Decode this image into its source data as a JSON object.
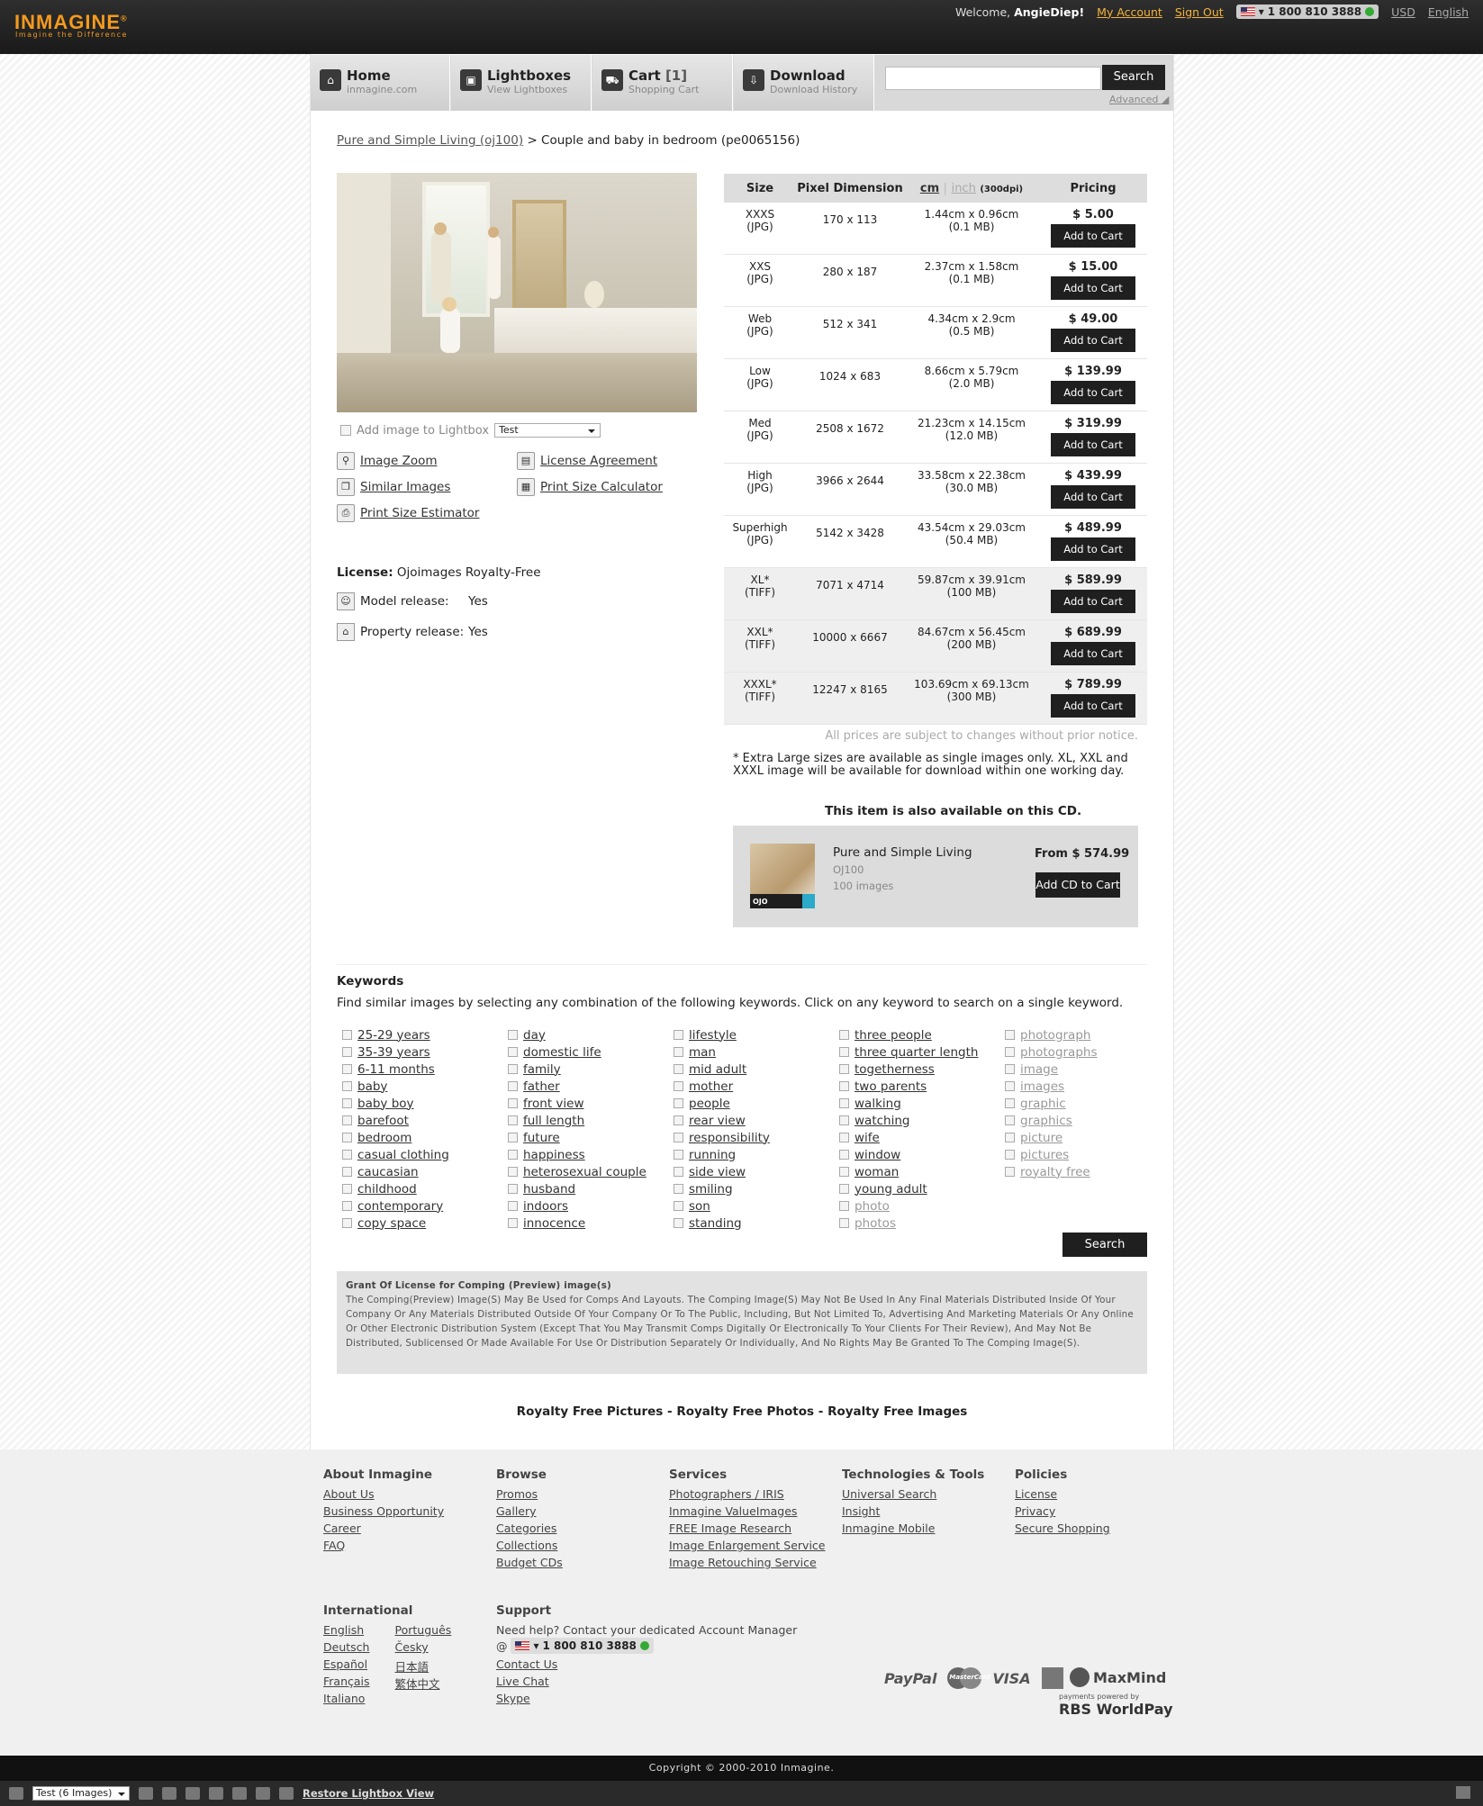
{
  "header": {
    "logo": "INMAGINE",
    "logo_mark": "®",
    "tagline": "Imagine the Difference",
    "welcome": "Welcome,",
    "username": "AngieDiep!",
    "my_account": "My Account",
    "sign_out": "Sign Out",
    "phone": "1 800 810 3888",
    "currency": "USD",
    "language": "English"
  },
  "nav": {
    "tabs": [
      {
        "title": "Home",
        "sub": "inmagine.com"
      },
      {
        "title": "Lightboxes",
        "sub": "View Lightboxes"
      },
      {
        "title": "Cart",
        "count": "[1]",
        "sub": "Shopping Cart"
      },
      {
        "title": "Download",
        "sub": "Download History"
      }
    ],
    "search_placeholder": "",
    "search_button": "Search",
    "advanced": "Advanced"
  },
  "breadcrumb": {
    "parent": "Pure and Simple Living (oj100)",
    "separator": ">",
    "current": "Couple and baby in bedroom (pe0065156)"
  },
  "image_panel": {
    "add_lightbox_label": "Add image to Lightbox",
    "lightbox_select": "Test",
    "tools": {
      "zoom": "Image Zoom",
      "license_agreement": "License Agreement",
      "similar": "Similar Images",
      "print_calc": "Print Size Calculator",
      "print_estimator": "Print Size Estimator"
    },
    "license_label": "License:",
    "license_value": "Ojoimages Royalty-Free",
    "model_release_label": "Model release:",
    "model_release_value": "Yes",
    "property_release_label": "Property release:",
    "property_release_value": "Yes"
  },
  "pricing": {
    "headers": {
      "size": "Size",
      "pixel": "Pixel Dimension",
      "cm": "cm",
      "sep": "|",
      "inch": "inch",
      "dpi": "(300dpi)",
      "pricing": "Pricing"
    },
    "add_label": "Add to Cart",
    "rows": [
      {
        "size": "XXXS",
        "fmt": "(JPG)",
        "pixels": "170 x 113",
        "dim": "1.44cm x 0.96cm",
        "mb": "(0.1 MB)",
        "price": "$ 5.00"
      },
      {
        "size": "XXS",
        "fmt": "(JPG)",
        "pixels": "280 x 187",
        "dim": "2.37cm x 1.58cm",
        "mb": "(0.1 MB)",
        "price": "$ 15.00"
      },
      {
        "size": "Web",
        "fmt": "(JPG)",
        "pixels": "512 x 341",
        "dim": "4.34cm x 2.9cm",
        "mb": "(0.5 MB)",
        "price": "$ 49.00"
      },
      {
        "size": "Low",
        "fmt": "(JPG)",
        "pixels": "1024 x 683",
        "dim": "8.66cm x 5.79cm",
        "mb": "(2.0 MB)",
        "price": "$ 139.99"
      },
      {
        "size": "Med",
        "fmt": "(JPG)",
        "pixels": "2508 x 1672",
        "dim": "21.23cm x 14.15cm",
        "mb": "(12.0 MB)",
        "price": "$ 319.99"
      },
      {
        "size": "High",
        "fmt": "(JPG)",
        "pixels": "3966 x 2644",
        "dim": "33.58cm x 22.38cm",
        "mb": "(30.0 MB)",
        "price": "$ 439.99"
      },
      {
        "size": "Superhigh",
        "fmt": "(JPG)",
        "pixels": "5142 x 3428",
        "dim": "43.54cm x 29.03cm",
        "mb": "(50.4 MB)",
        "price": "$ 489.99"
      },
      {
        "size": "XL*",
        "fmt": "(TIFF)",
        "pixels": "7071 x 4714",
        "dim": "59.87cm x 39.91cm",
        "mb": "(100 MB)",
        "price": "$ 589.99"
      },
      {
        "size": "XXL*",
        "fmt": "(TIFF)",
        "pixels": "10000 x 6667",
        "dim": "84.67cm x 56.45cm",
        "mb": "(200 MB)",
        "price": "$ 689.99"
      },
      {
        "size": "XXXL*",
        "fmt": "(TIFF)",
        "pixels": "12247 x 8165",
        "dim": "103.69cm x 69.13cm",
        "mb": "(300 MB)",
        "price": "$ 789.99"
      }
    ],
    "notice": "All prices are subject to changes without prior notice.",
    "xl_note": "* Extra Large sizes are available as single images only. XL, XXL and XXXL image will be available for download within one working day."
  },
  "cd": {
    "heading": "This item is also available on this CD.",
    "title": "Pure and Simple Living",
    "code": "OJ100",
    "count": "100 images",
    "price": "From $ 574.99",
    "button": "Add CD to Cart",
    "thumb_label": "OJO"
  },
  "keywords": {
    "title": "Keywords",
    "description": "Find similar images by selecting any combination of the following keywords. Click on any keyword to search on a single keyword.",
    "columns": [
      [
        "25-29 years",
        "35-39 years",
        "6-11 months",
        "baby",
        "baby boy",
        "barefoot",
        "bedroom",
        "casual clothing",
        "caucasian",
        "childhood",
        "contemporary",
        "copy space"
      ],
      [
        "day",
        "domestic life",
        "family",
        "father",
        "front view",
        "full length",
        "future",
        "happiness",
        "heterosexual couple",
        "husband",
        "indoors",
        "innocence"
      ],
      [
        "lifestyle",
        "man",
        "mid adult",
        "mother",
        "people",
        "rear view",
        "responsibility",
        "running",
        "side view",
        "smiling",
        "son",
        "standing"
      ],
      [
        "three people",
        "three quarter length",
        "togetherness",
        "two parents",
        "walking",
        "watching",
        "wife",
        "window",
        "woman",
        "young adult",
        "photo",
        "photos"
      ],
      [
        "photograph",
        "photographs",
        "image",
        "images",
        "graphic",
        "graphics",
        "picture",
        "pictures",
        "royalty free"
      ]
    ],
    "grey_words": [
      "photo",
      "photos",
      "photograph",
      "photographs",
      "image",
      "images",
      "graphic",
      "graphics",
      "picture",
      "pictures",
      "royalty free"
    ],
    "search_button": "Search"
  },
  "grant": {
    "title": "Grant Of License for Comping (Preview) image(s)",
    "body": "The Comping(Preview) Image(S) May Be Used for Comps And Layouts. The Comping Image(S) May Not Be Used In Any Final Materials Distributed Inside Of Your Company Or Any Materials Distributed Outside Of Your Company Or To The Public, Including, But Not Limited To, Advertising And Marketing Materials Or Any Online Or Other Electronic Distribution System (Except That You May Transmit Comps Digitally Or Electronically To Your Clients For Their Review), And May Not Be Distributed, Sublicensed Or Made Available For Use Or Distribution Separately Or Individually, And No Rights May Be Granted To The Comping Image(S)."
  },
  "royalty_links": {
    "a": "Royalty Free Pictures",
    "b": "Royalty Free Photos",
    "c": "Royalty Free Images",
    "sep": " - "
  },
  "footer": {
    "about": {
      "title": "About Inmagine",
      "links": [
        "About Us",
        "Business Opportunity",
        "Career",
        "FAQ"
      ]
    },
    "browse": {
      "title": "Browse",
      "links": [
        "Promos",
        "Gallery",
        "Categories",
        "Collections",
        "Budget CDs"
      ]
    },
    "services": {
      "title": "Services",
      "links": [
        "Photographers / IRIS",
        "Inmagine ValueImages",
        "FREE Image Research",
        "Image Enlargement Service",
        "Image Retouching Service"
      ]
    },
    "tech": {
      "title": "Technologies & Tools",
      "links": [
        "Universal Search",
        "Insight",
        "Inmagine Mobile"
      ]
    },
    "policies": {
      "title": "Policies",
      "links": [
        "License",
        "Privacy",
        "Secure Shopping"
      ]
    },
    "international": {
      "title": "International",
      "col1": [
        "English",
        "Deutsch",
        "Español",
        "Français",
        "Italiano"
      ],
      "col2": [
        "Português",
        "Česky",
        "日本語",
        "繁体中文"
      ]
    },
    "support": {
      "title": "Support",
      "text": "Need help? Contact your dedicated Account Manager",
      "at": "@",
      "phone": "1 800 810 3888",
      "links": [
        "Contact Us",
        "Live Chat",
        "Skype"
      ]
    },
    "payments": {
      "paypal": "PayPal",
      "mastercard": "MasterCard",
      "visa": "VISA",
      "maxmind": "MaxMind",
      "rbs_small": "payments powered by",
      "rbs": "RBS WorldPay"
    },
    "copyright": "Copyright © 2000-2010 Inmagine."
  },
  "lightbox_bar": {
    "select": "Test (6 Images)",
    "restore": "Restore Lightbox View"
  }
}
